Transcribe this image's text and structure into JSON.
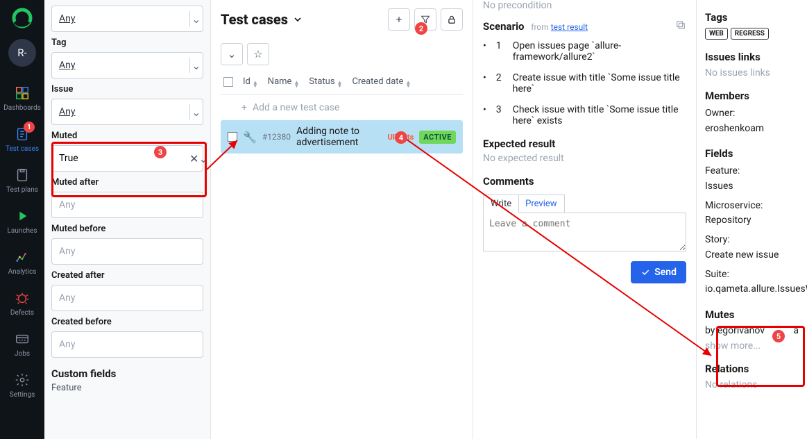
{
  "nav": {
    "avatar": "R-",
    "items": [
      {
        "label": "Dashboards"
      },
      {
        "label": "Test cases",
        "badge": "1"
      },
      {
        "label": "Test plans"
      },
      {
        "label": "Launches"
      },
      {
        "label": "Analytics"
      },
      {
        "label": "Defects"
      },
      {
        "label": "Jobs"
      },
      {
        "label": "Settings"
      }
    ]
  },
  "filters": {
    "groups": [
      {
        "label": "",
        "placeholder": "Any"
      },
      {
        "label": "Tag",
        "placeholder": "Any"
      },
      {
        "label": "Issue",
        "placeholder": "Any"
      },
      {
        "label": "Muted",
        "value": "True"
      },
      {
        "label": "Muted after",
        "placeholder": "Any"
      },
      {
        "label": "Muted before",
        "placeholder": "Any"
      },
      {
        "label": "Created after",
        "placeholder": "Any"
      },
      {
        "label": "Created before",
        "placeholder": "Any"
      }
    ],
    "custom_heading": "Custom fields",
    "custom_sub": "Feature"
  },
  "cases": {
    "title": "Test cases",
    "columns": [
      "Id",
      "Name",
      "Status",
      "Created date"
    ],
    "add_hint": "Add a new test case",
    "row": {
      "id": "#12380",
      "name": "Adding note to advertisement",
      "tests_label": "UITests",
      "pill": "ACTIVE"
    }
  },
  "detail": {
    "no_precondition": "No precondition",
    "scenario_label": "Scenario",
    "scenario_from": "from",
    "scenario_link": "test result",
    "steps": [
      "Open issues page `allure-framework/allure2`",
      "Create issue with title `Some issue title here`",
      "Check issue with title `Some issue title here` exists"
    ],
    "expected_label": "Expected result",
    "expected_none": "No expected result",
    "comments_label": "Comments",
    "tabs": {
      "write": "Write",
      "preview": "Preview"
    },
    "comment_placeholder": "Leave a comment",
    "send": "Send"
  },
  "meta": {
    "tags_label": "Tags",
    "tags": [
      "WEB",
      "REGRESS"
    ],
    "issues_label": "Issues links",
    "issues_none": "No issues links",
    "members_label": "Members",
    "owner_k": "Owner:",
    "owner_v": "eroshenkoam",
    "fields_label": "Fields",
    "fields": [
      {
        "k": "Feature:",
        "v": "Issues"
      },
      {
        "k": "Microservice:",
        "v": "Repository"
      },
      {
        "k": "Story:",
        "v": "Create new issue"
      },
      {
        "k": "Suite:",
        "v": "io.qameta.allure.IssuesWebTest"
      }
    ],
    "mutes_label": "Mutes",
    "mutes_by": "by egorivanov",
    "mutes_time": "a",
    "show_more": "show more...",
    "relations_label": "Relations",
    "relations_none": "No relations"
  },
  "callouts": {
    "c2": "2",
    "c3": "3",
    "c4": "4",
    "c5": "5"
  }
}
